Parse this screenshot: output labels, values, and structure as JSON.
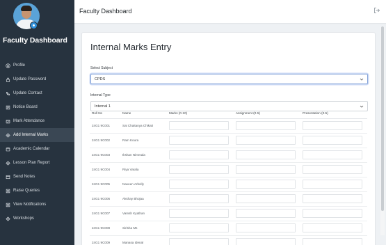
{
  "sidebar": {
    "brand": "Faculty Dashboard",
    "items": [
      {
        "label": "Profile",
        "icon": "profile-icon",
        "active": false
      },
      {
        "label": "Update Password",
        "icon": "lock-icon",
        "active": false
      },
      {
        "label": "Update Contact",
        "icon": "phone-icon",
        "active": false
      },
      {
        "label": "Notice Board",
        "icon": "notice-icon",
        "active": false
      },
      {
        "label": "Mark Attendance",
        "icon": "calendar-check-icon",
        "active": false
      },
      {
        "label": "Add Internal Marks",
        "icon": "diamond-icon",
        "active": true
      },
      {
        "label": "Academic Calendar",
        "icon": "calendar-icon",
        "active": false
      },
      {
        "label": "Lesson Plan Report",
        "icon": "diamond-icon",
        "active": false
      },
      {
        "label": "Send Notes",
        "icon": "notes-icon",
        "active": false
      },
      {
        "label": "Raise Queries",
        "icon": "query-icon",
        "active": false
      },
      {
        "label": "View Notifications",
        "icon": "bell-icon",
        "active": false
      },
      {
        "label": "Workshops",
        "icon": "diamond-icon",
        "active": false
      }
    ]
  },
  "topbar": {
    "title": "Faculty Dashboard"
  },
  "form": {
    "title": "Internal Marks Entry",
    "subject_label": "Select Subject",
    "subject_value": "CPDS",
    "internal_label": "Internal Type",
    "internal_value": "Internal 1"
  },
  "table": {
    "columns": [
      "Roll No",
      "Name",
      "Marks (0-10)",
      "Assignment (0-5)",
      "Presentation (0-5)"
    ],
    "rows": [
      {
        "roll": "24G1 9C001",
        "name": "Sai Chaitanya Chikati"
      },
      {
        "roll": "24G1 9C002",
        "name": "Ram Koura"
      },
      {
        "roll": "24G1 9C003",
        "name": "Ikshan Nimmala"
      },
      {
        "roll": "24G1 9C004",
        "name": "Riya Varala"
      },
      {
        "roll": "24G1 9C005",
        "name": "Naveen Arbolly"
      },
      {
        "roll": "24G1 9C006",
        "name": "Akshay Bhojaa"
      },
      {
        "roll": "24G1 9C007",
        "name": "Vamsh Kyathan"
      },
      {
        "roll": "24G1 9C008",
        "name": "Sirisha Ms"
      },
      {
        "roll": "24G1 9C009",
        "name": "Manasa Idenal"
      }
    ]
  },
  "colors": {
    "sidebar_bg": "#27333f",
    "accent_focus": "#86a4d8"
  }
}
